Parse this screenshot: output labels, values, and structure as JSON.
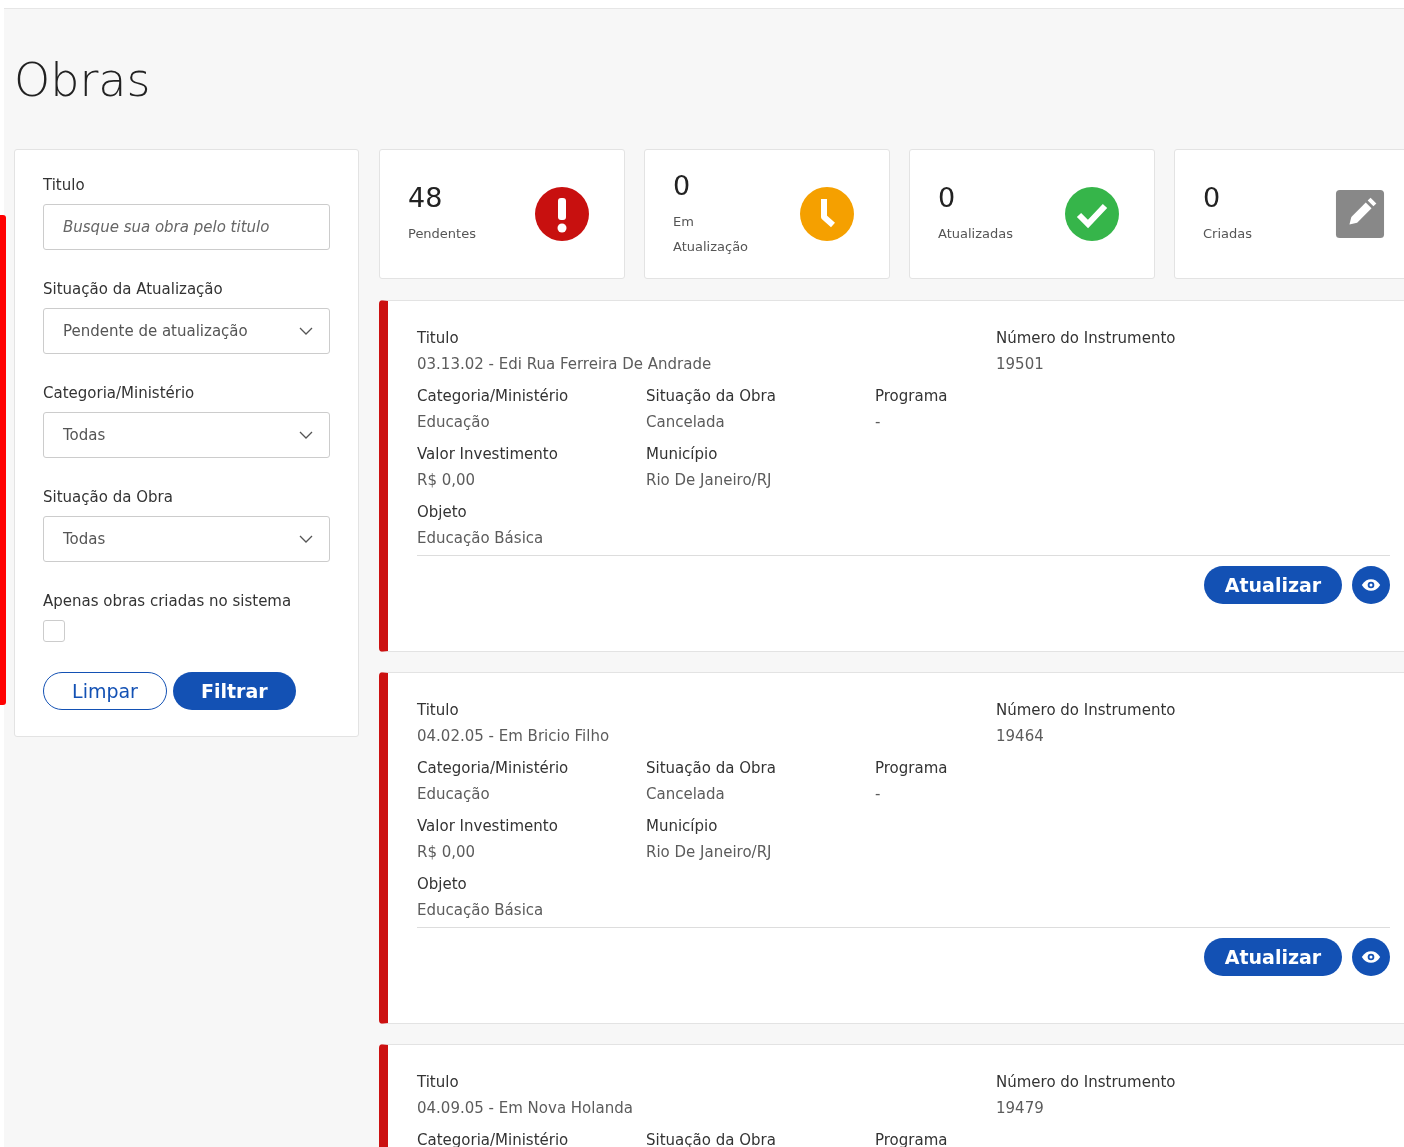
{
  "page": {
    "title": "Obras"
  },
  "filters": {
    "fields": [
      {
        "kind": "text",
        "label": "Titulo",
        "placeholder": "Busque sua obra pelo titulo"
      },
      {
        "kind": "select",
        "label": "Situação da Atualização",
        "value": "Pendente de atualização"
      },
      {
        "kind": "select",
        "label": "Categoria/Ministério",
        "value": "Todas"
      },
      {
        "kind": "select",
        "label": "Situação da Obra",
        "value": "Todas"
      },
      {
        "kind": "checkbox",
        "label": "Apenas obras criadas no sistema",
        "checked": false
      }
    ],
    "buttons": [
      {
        "kind": "outline",
        "label": "Limpar"
      },
      {
        "kind": "primary",
        "label": "Filtrar"
      }
    ]
  },
  "stats": [
    {
      "kind": "alert",
      "value": "48",
      "label": "Pendentes",
      "color": "#c8100f"
    },
    {
      "kind": "clock",
      "value": "0",
      "label": "Em Atualização",
      "color": "#f5a000"
    },
    {
      "kind": "check",
      "value": "0",
      "label": "Atualizadas",
      "color": "#36b54a"
    },
    {
      "kind": "edit",
      "value": "0",
      "label": "Criadas",
      "color": "#888888"
    }
  ],
  "results": [
    {
      "title": {
        "label": "Titulo",
        "value": "03.13.02 - Edi Rua Ferreira De Andrade"
      },
      "instrument": {
        "label": "Número do Instrumento",
        "value": "19501"
      },
      "rows": [
        [
          {
            "label": "Categoria/Ministério",
            "value": "Educação"
          },
          {
            "label": "Situação da Obra",
            "value": "Cancelada"
          },
          {
            "label": "Programa",
            "value": "-"
          }
        ],
        [
          {
            "label": "Valor Investimento",
            "value": "R$ 0,00"
          },
          {
            "label": "Município",
            "value": "Rio De Janeiro/RJ"
          }
        ],
        [
          {
            "label": "Objeto",
            "value": "Educação Básica"
          }
        ]
      ],
      "actions": {
        "update": "Atualizar"
      }
    },
    {
      "title": {
        "label": "Titulo",
        "value": "04.02.05 - Em Bricio Filho"
      },
      "instrument": {
        "label": "Número do Instrumento",
        "value": "19464"
      },
      "rows": [
        [
          {
            "label": "Categoria/Ministério",
            "value": "Educação"
          },
          {
            "label": "Situação da Obra",
            "value": "Cancelada"
          },
          {
            "label": "Programa",
            "value": "-"
          }
        ],
        [
          {
            "label": "Valor Investimento",
            "value": "R$ 0,00"
          },
          {
            "label": "Município",
            "value": "Rio De Janeiro/RJ"
          }
        ],
        [
          {
            "label": "Objeto",
            "value": "Educação Básica"
          }
        ]
      ],
      "actions": {
        "update": "Atualizar"
      }
    },
    {
      "title": {
        "label": "Titulo",
        "value": "04.09.05 - Em Nova Holanda"
      },
      "instrument": {
        "label": "Número do Instrumento",
        "value": "19479"
      },
      "rows": [
        [
          {
            "label": "Categoria/Ministério"
          },
          {
            "label": "Situação da Obra"
          },
          {
            "label": "Programa"
          }
        ]
      ]
    }
  ]
}
